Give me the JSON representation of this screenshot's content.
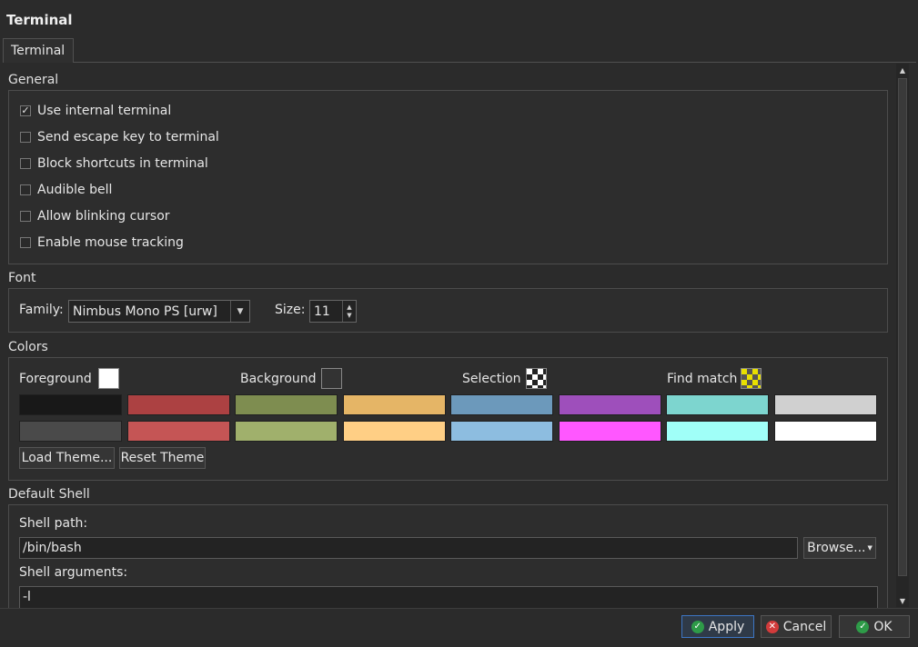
{
  "window": {
    "title": "Terminal"
  },
  "tabs": [
    {
      "label": "Terminal"
    }
  ],
  "general": {
    "title": "General",
    "options": [
      {
        "label": "Use internal terminal",
        "checked": true
      },
      {
        "label": "Send escape key to terminal",
        "checked": false
      },
      {
        "label": "Block shortcuts in terminal",
        "checked": false
      },
      {
        "label": "Audible bell",
        "checked": false
      },
      {
        "label": "Allow blinking cursor",
        "checked": false
      },
      {
        "label": "Enable mouse tracking",
        "checked": false
      }
    ]
  },
  "font": {
    "title": "Font",
    "family_label": "Family:",
    "family_value": "Nimbus Mono PS [urw]",
    "size_label": "Size:",
    "size_value": "11"
  },
  "colors": {
    "title": "Colors",
    "foreground_label": "Foreground",
    "background_label": "Background",
    "selection_label": "Selection",
    "find_match_label": "Find match",
    "foreground_color": "#ffffff",
    "background_color": "#333333",
    "palette_row1": [
      "#181818",
      "#ac4142",
      "#7e8d50",
      "#e5b566",
      "#6c99bb",
      "#9e4fbb",
      "#7dd5cf",
      "#d0d0d0"
    ],
    "palette_row2": [
      "#4a4a4a",
      "#c55555",
      "#a0b06c",
      "#ffcf85",
      "#8dbde0",
      "#ff57ff",
      "#a0fff8",
      "#ffffff"
    ],
    "load_theme_button": "Load Theme...",
    "reset_theme_button": "Reset Theme"
  },
  "shell": {
    "title": "Default Shell",
    "path_label": "Shell path:",
    "path_value": "/bin/bash",
    "browse_button": "Browse...",
    "args_label": "Shell arguments:",
    "args_value": "-l"
  },
  "buttons": {
    "apply": "Apply",
    "cancel": "Cancel",
    "ok": "OK"
  },
  "icons": {
    "checkmark": "check-icon",
    "cancel": "cancel-icon"
  }
}
